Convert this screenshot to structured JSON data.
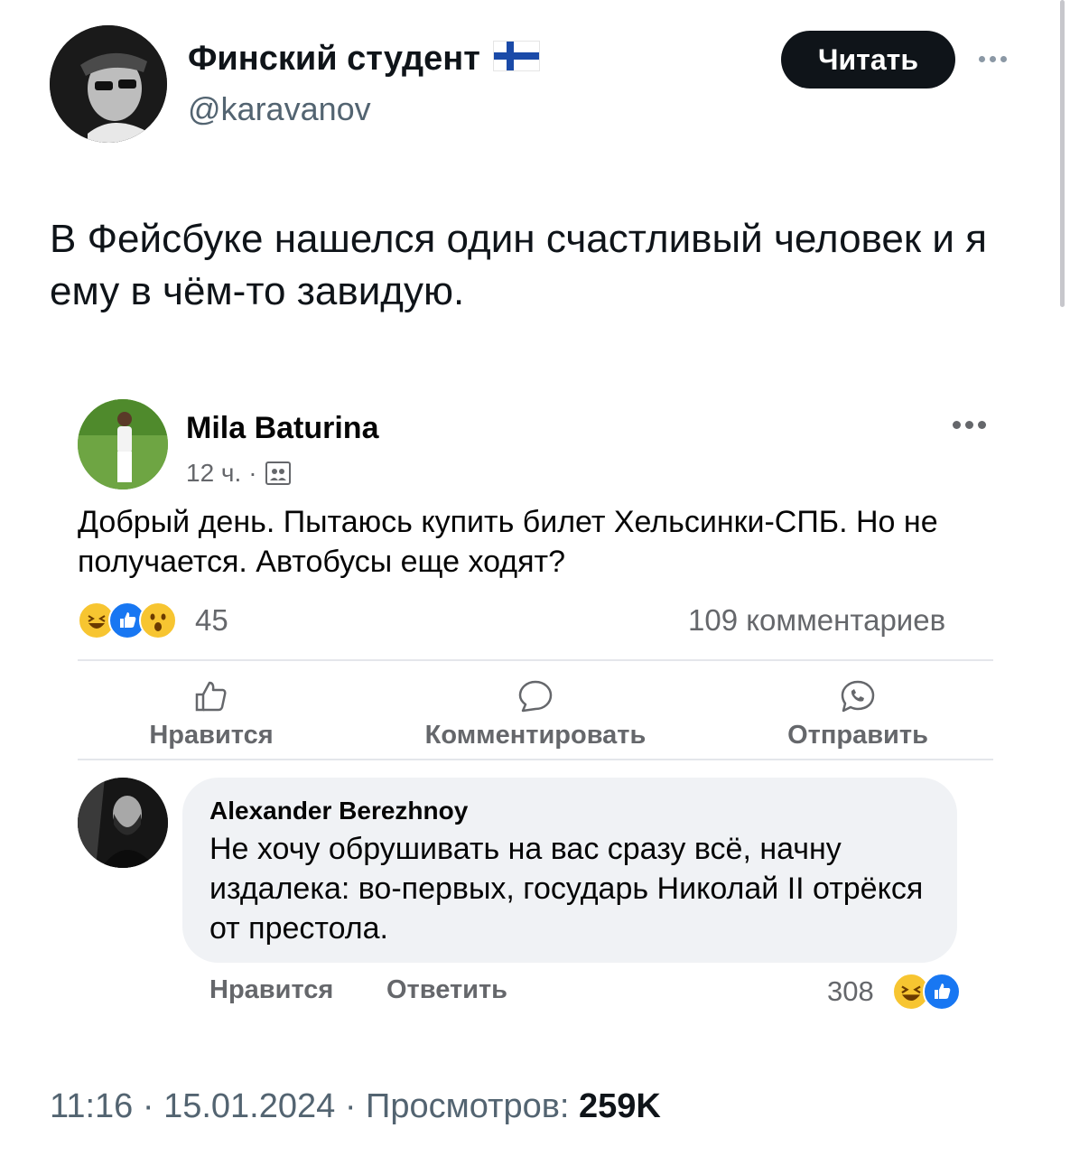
{
  "tweet": {
    "author_name": "Финский студент",
    "author_handle": "@karavanov",
    "follow_label": "Читать",
    "text": "В Фейсбуке нашелся один счастливый человек и я ему в чём-то завидую.",
    "time": "11:16",
    "date": "15.01.2024",
    "views_label": "Просмотров:",
    "views_count": "259K"
  },
  "post": {
    "author": "Mila Baturina",
    "time": "12 ч.",
    "text": "Добрый день. Пытаюсь купить билет Хельсинки-СПБ. Но не получается. Автобусы еще ходят?",
    "reaction_count": "45",
    "comments_count": "109 комментариев",
    "actions": {
      "like": "Нравится",
      "comment": "Комментировать",
      "share": "Отправить"
    }
  },
  "comment": {
    "author": "Alexander Berezhnoy",
    "text": "Не хочу обрушивать на вас сразу всё, начну издалека: во-первых, государь Николай II отрёкся от престола.",
    "like_label": "Нравится",
    "reply_label": "Ответить",
    "reaction_count": "308"
  },
  "colors": {
    "fb_blue": "#1877f2",
    "emoji_yellow": "#f7c531",
    "muted": "#65676b",
    "twitter_gray": "#536471"
  },
  "icons": [
    "flag-finland-icon",
    "more-icon",
    "globe-friends-icon",
    "haha-icon",
    "like-icon",
    "wow-icon",
    "thumbs-up-icon",
    "comment-icon",
    "messenger-icon"
  ]
}
